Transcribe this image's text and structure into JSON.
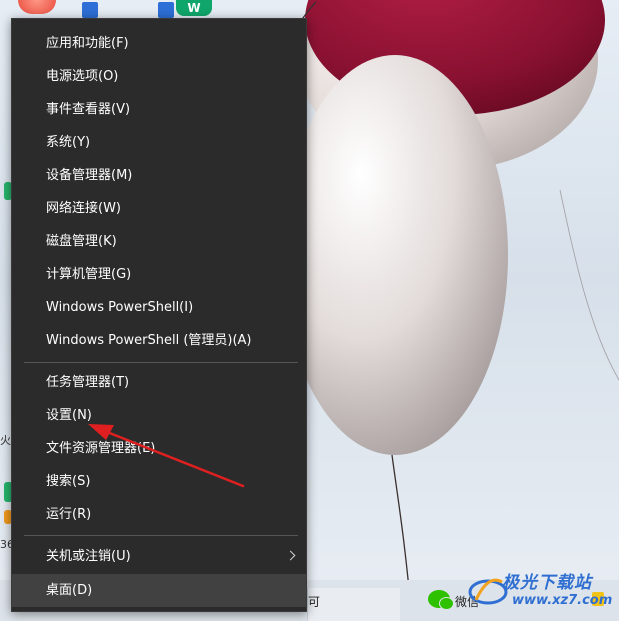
{
  "menu": {
    "items": [
      {
        "label": "应用和功能(F)"
      },
      {
        "label": "电源选项(O)"
      },
      {
        "label": "事件查看器(V)"
      },
      {
        "label": "系统(Y)"
      },
      {
        "label": "设备管理器(M)"
      },
      {
        "label": "网络连接(W)"
      },
      {
        "label": "磁盘管理(K)"
      },
      {
        "label": "计算机管理(G)"
      },
      {
        "label": "Windows PowerShell(I)"
      },
      {
        "label": "Windows PowerShell (管理员)(A)"
      },
      {
        "label": "任务管理器(T)"
      },
      {
        "label": "设置(N)"
      },
      {
        "label": "文件资源管理器(E)"
      },
      {
        "label": "搜索(S)"
      },
      {
        "label": "运行(R)"
      },
      {
        "label": "关机或注销(U)"
      },
      {
        "label": "桌面(D)"
      }
    ]
  },
  "desktop": {
    "fragments": [
      "火",
      "36"
    ]
  },
  "taskbar": {
    "partial_label": "可",
    "wechat_label": "微信"
  },
  "watermark": {
    "title": "极光下载站",
    "url": "www.xz7.com"
  },
  "colors": {
    "menu_bg": "#2b2b2b",
    "menu_text": "#ffffff",
    "menu_active": "#414141",
    "arrow": "#e02020",
    "balloon_dark": "#8b1030",
    "balloon_light": "#e4dcda"
  }
}
